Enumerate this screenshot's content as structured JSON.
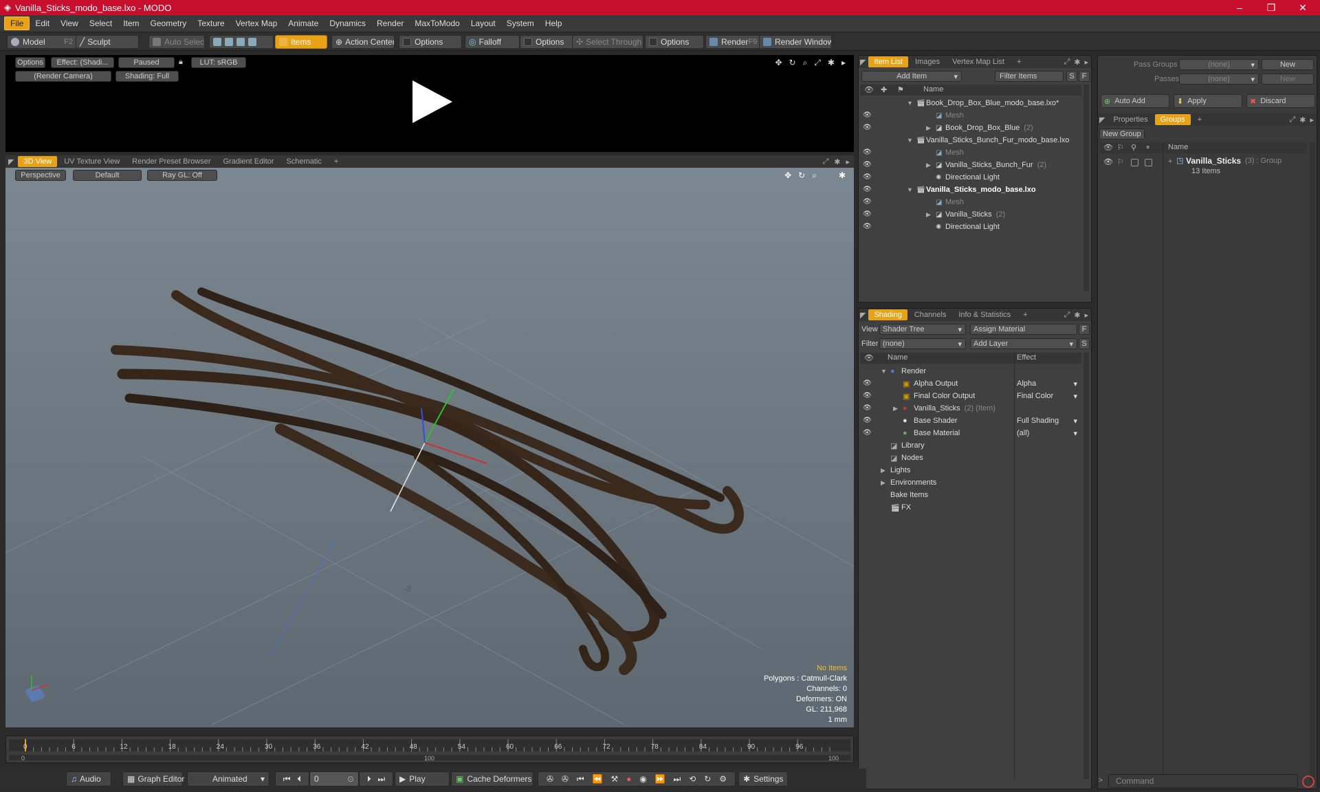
{
  "window": {
    "title": "Vanilla_Sticks_modo_base.lxo - MODO",
    "minimize": "–",
    "maximize": "❐",
    "close": "✕"
  },
  "menu": [
    "File",
    "Edit",
    "View",
    "Select",
    "Item",
    "Geometry",
    "Texture",
    "Vertex Map",
    "Animate",
    "Dynamics",
    "Render",
    "MaxToModo",
    "Layout",
    "System",
    "Help"
  ],
  "toolbar": {
    "model": "Model",
    "model_key": "F2",
    "sculpt": "Sculpt",
    "auto_select": "Auto Select",
    "items": "Items",
    "action_center": "Action Center",
    "options1": "Options",
    "falloff": "Falloff",
    "options2": "Options",
    "select_through": "Select Through",
    "options3": "Options",
    "render": "Render",
    "render_key": "F9",
    "render_window": "Render Window"
  },
  "render_view": {
    "options": "Options",
    "effect": "Effect: (Shadi...",
    "paused": "Paused",
    "lut": "LUT: sRGB",
    "camera": "(Render Camera)",
    "shading": "Shading: Full"
  },
  "viewport_tabs": [
    "3D View",
    "UV Texture View",
    "Render Preset Browser",
    "Gradient Editor",
    "Schematic",
    "+"
  ],
  "viewport": {
    "perspective": "Perspective",
    "default": "Default",
    "raygl": "Ray GL: Off",
    "hud": {
      "no_items": "No Items",
      "polygons": "Polygons : Catmull-Clark",
      "channels": "Channels: 0",
      "deformers": "Deformers: ON",
      "gl": "GL: 211,968",
      "scale": "1 mm"
    },
    "axis_label": "-2"
  },
  "item_list": {
    "tabs": [
      "Item List",
      "Images",
      "Vertex Map List",
      "+"
    ],
    "add_item": "Add Item",
    "filter_items": "Filter Items",
    "s": "S",
    "f": "F",
    "name_header": "Name",
    "rows": [
      {
        "label": "Book_Drop_Box_Blue_modo_base.lxo*",
        "count": "",
        "indent": 0,
        "bold": false,
        "dim": false,
        "eye": false
      },
      {
        "label": "Mesh",
        "count": "",
        "indent": 1,
        "bold": false,
        "dim": true,
        "eye": true
      },
      {
        "label": "Book_Drop_Box_Blue",
        "count": "(2)",
        "indent": 1,
        "bold": false,
        "dim": false,
        "eye": true
      },
      {
        "label": "Vanilla_Sticks_Bunch_Fur_modo_base.lxo",
        "count": "",
        "indent": 0,
        "bold": false,
        "dim": false,
        "eye": false
      },
      {
        "label": "Mesh",
        "count": "",
        "indent": 1,
        "bold": false,
        "dim": true,
        "eye": true
      },
      {
        "label": "Vanilla_Sticks_Bunch_Fur",
        "count": "(2)",
        "indent": 1,
        "bold": false,
        "dim": false,
        "eye": true
      },
      {
        "label": "Directional Light",
        "count": "",
        "indent": 1,
        "bold": false,
        "dim": false,
        "eye": true
      },
      {
        "label": "Vanilla_Sticks_modo_base.lxo",
        "count": "",
        "indent": 0,
        "bold": true,
        "dim": false,
        "eye": true
      },
      {
        "label": "Mesh",
        "count": "",
        "indent": 1,
        "bold": false,
        "dim": true,
        "eye": true
      },
      {
        "label": "Vanilla_Sticks",
        "count": "(2)",
        "indent": 1,
        "bold": false,
        "dim": false,
        "eye": true
      },
      {
        "label": "Directional Light",
        "count": "",
        "indent": 1,
        "bold": false,
        "dim": false,
        "eye": true
      }
    ]
  },
  "shading": {
    "tabs": [
      "Shading",
      "Channels",
      "Info & Statistics",
      "+"
    ],
    "view_label": "View",
    "view_value": "Shader Tree",
    "assign_material": "Assign Material",
    "filter_label": "Filter",
    "filter_value": "(none)",
    "add_layer": "Add Layer",
    "f": "F",
    "s": "S",
    "name_header": "Name",
    "effect_header": "Effect",
    "rows": [
      {
        "label": "Render",
        "count": "",
        "effect": "",
        "indent": 0
      },
      {
        "label": "Alpha Output",
        "count": "",
        "effect": "Alpha",
        "indent": 1
      },
      {
        "label": "Final Color Output",
        "count": "",
        "effect": "Final Color",
        "indent": 1
      },
      {
        "label": "Vanilla_Sticks",
        "count": "(2) (Item)",
        "effect": "",
        "indent": 1
      },
      {
        "label": "Base Shader",
        "count": "",
        "effect": "Full Shading",
        "indent": 1
      },
      {
        "label": "Base Material",
        "count": "",
        "effect": "(all)",
        "indent": 1
      },
      {
        "label": "Library",
        "count": "",
        "effect": "",
        "indent": 0
      },
      {
        "label": "Nodes",
        "count": "",
        "effect": "",
        "indent": 0
      },
      {
        "label": "Lights",
        "count": "",
        "effect": "",
        "indent": 0
      },
      {
        "label": "Environments",
        "count": "",
        "effect": "",
        "indent": 0
      },
      {
        "label": "Bake Items",
        "count": "",
        "effect": "",
        "indent": 0
      },
      {
        "label": "FX",
        "count": "",
        "effect": "",
        "indent": 0
      }
    ]
  },
  "right": {
    "pass_groups": "Pass Groups",
    "pass_groups_value": "(none)",
    "new1": "New",
    "passes": "Passes",
    "passes_value": "(none)",
    "new2": "New",
    "auto_add": "Auto Add",
    "apply": "Apply",
    "discard": "Discard",
    "tabs": [
      "Properties",
      "Groups",
      "+"
    ],
    "new_group": "New Group",
    "name_header": "Name",
    "group_name": "Vanilla_Sticks",
    "group_meta": "(3) : Group",
    "group_items": "13 Items",
    "command_placeholder": "Command"
  },
  "timeline": {
    "ticks": [
      "0",
      "6",
      "12",
      "18",
      "24",
      "30",
      "36",
      "42",
      "48",
      "54",
      "60",
      "66",
      "72",
      "78",
      "84",
      "90",
      "96"
    ],
    "sub": [
      "0",
      "100",
      "100"
    ]
  },
  "bottom": {
    "audio": "Audio",
    "graph_editor": "Graph Editor",
    "animated": "Animated",
    "frame": "0",
    "play": "Play",
    "cache_deformers": "Cache Deformers",
    "settings": "Settings"
  }
}
